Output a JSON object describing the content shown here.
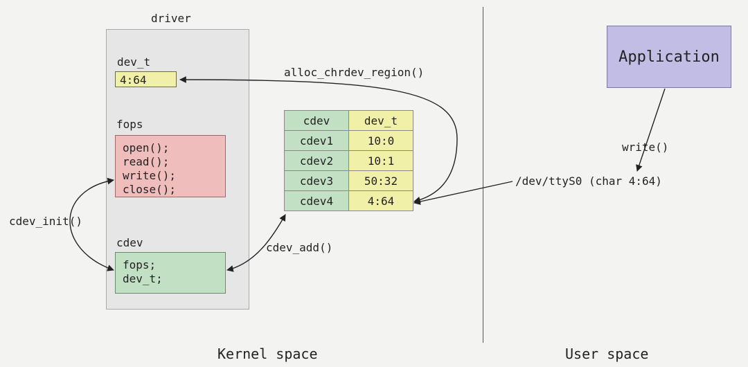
{
  "driver": {
    "title": "driver",
    "devt_label": "dev_t",
    "devt_value": "4:64",
    "fops_label": "fops",
    "fops_lines": {
      "l1": "open();",
      "l2": "read();",
      "l3": "write();",
      "l4": "close();"
    },
    "cdev_label": "cdev",
    "cdev_lines": {
      "l1": "fops;",
      "l2": "dev_t;"
    }
  },
  "table": {
    "head": {
      "c1": "cdev",
      "c2": "dev_t"
    },
    "rows": {
      "r1": {
        "c1": "cdev1",
        "c2": "10:0"
      },
      "r2": {
        "c1": "cdev2",
        "c2": "10:1"
      },
      "r3": {
        "c1": "cdev3",
        "c2": "50:32"
      },
      "r4": {
        "c1": "cdev4",
        "c2": "4:64"
      }
    }
  },
  "app": {
    "label": "Application"
  },
  "labels": {
    "alloc": "alloc_chrdev_region()",
    "cdev_init": "cdev_init()",
    "cdev_add": "cdev_add()",
    "write": "write()",
    "devpath": "/dev/ttyS0 (char 4:64)",
    "kspace": "Kernel space",
    "uspace": "User space"
  }
}
